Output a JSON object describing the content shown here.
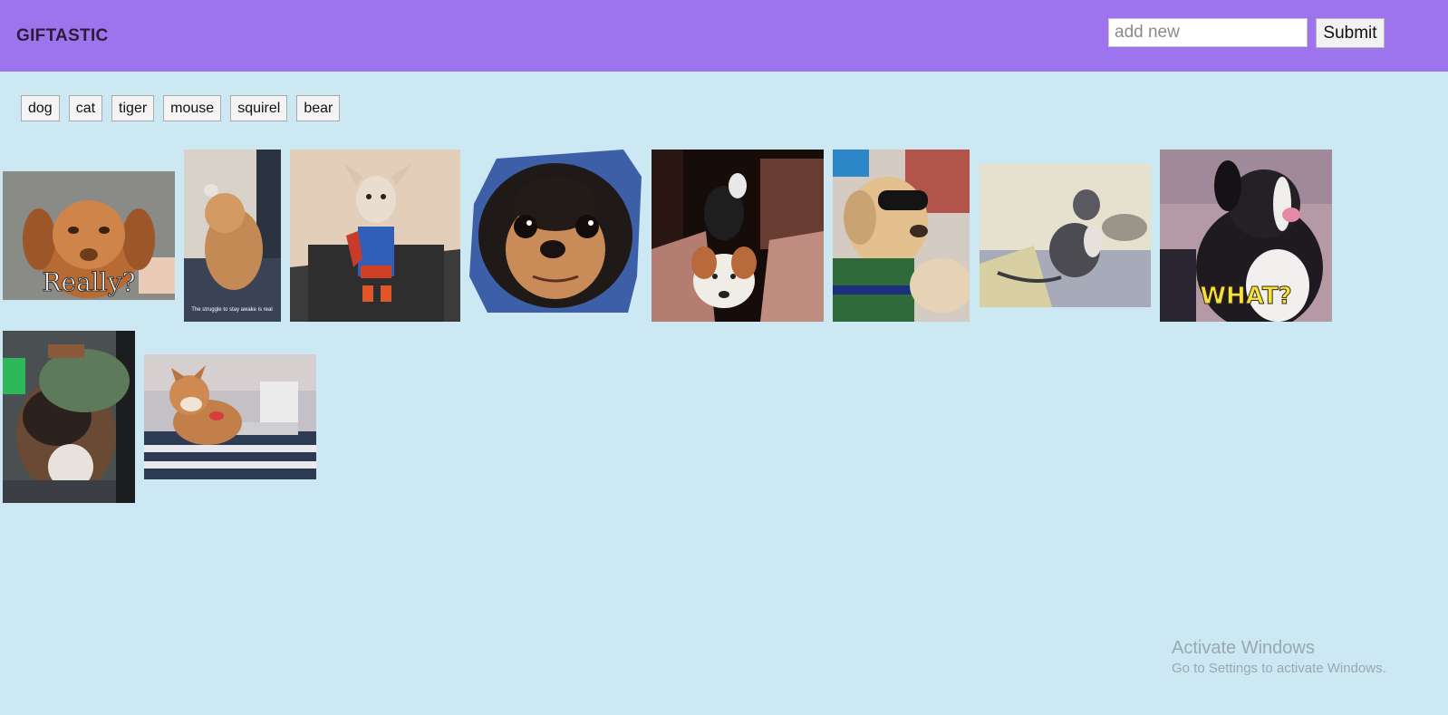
{
  "header": {
    "brand": "GIFTASTIC",
    "input_placeholder": "add new",
    "input_value": "",
    "submit_label": "Submit"
  },
  "topics": [
    "dog",
    "cat",
    "tiger",
    "mouse",
    "squirel",
    "bear"
  ],
  "gifs": [
    {
      "subject": "puppy-really",
      "caption": "Really?"
    },
    {
      "subject": "sleepy-puppy",
      "caption": "The struggle to stay awake is real"
    },
    {
      "subject": "superman-chihuahua",
      "caption": ""
    },
    {
      "subject": "chihuahua-closeup",
      "caption": ""
    },
    {
      "subject": "dog-under-couch",
      "caption": ""
    },
    {
      "subject": "dog-sunglasses-driving",
      "caption": ""
    },
    {
      "subject": "dog-on-bed",
      "caption": ""
    },
    {
      "subject": "dog-what",
      "caption": "WHAT?"
    },
    {
      "subject": "dog-in-beanie",
      "caption": ""
    },
    {
      "subject": "shiba-laptop",
      "caption": ""
    }
  ],
  "watermark": {
    "title": "Activate Windows",
    "subtitle": "Go to Settings to activate Windows."
  },
  "colors": {
    "header_bg": "#9e73ee",
    "page_bg": "#cbe8f3"
  }
}
